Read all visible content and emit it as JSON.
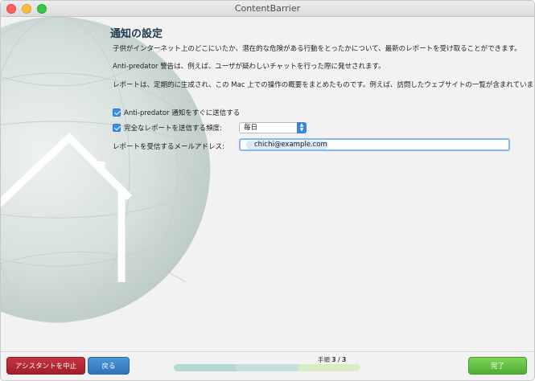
{
  "window": {
    "title": "ContentBarrier"
  },
  "main": {
    "heading": "通知の設定",
    "paragraphs": [
      "子供がインターネット上のどこにいたか、潜在的な危険がある行動をとったかについて、最新のレポートを受け取ることができます。",
      "Anti-predator 警告は、例えば、ユーザが疑わしいチャットを行った際に発せされます。",
      "レポートは、定期的に生成され、この Mac 上での操作の概要をまとめたものです。例えば、訪問したウェブサイトの一覧が含まれています。"
    ],
    "anti_predator_checkbox": {
      "label": "Anti-predator 通知をすぐに送信する",
      "checked": true
    },
    "full_report_checkbox": {
      "label": "完全なレポートを送信する頻度:",
      "checked": true
    },
    "frequency_select": {
      "value": "毎日"
    },
    "email": {
      "label": "レポートを受信するメールアドレス:",
      "value": "chichi@example.com"
    }
  },
  "footer": {
    "abort_label": "アシスタントを中止",
    "back_label": "戻る",
    "done_label": "完了",
    "step_prefix": "手順",
    "step_current": "3",
    "step_total": "3",
    "progress_fraction": 1.0
  },
  "colors": {
    "abort": "#b02a36",
    "back": "#3e86c8",
    "done": "#62c044",
    "heading": "#1f3b4d",
    "checkbox": "#3a8ee6"
  }
}
